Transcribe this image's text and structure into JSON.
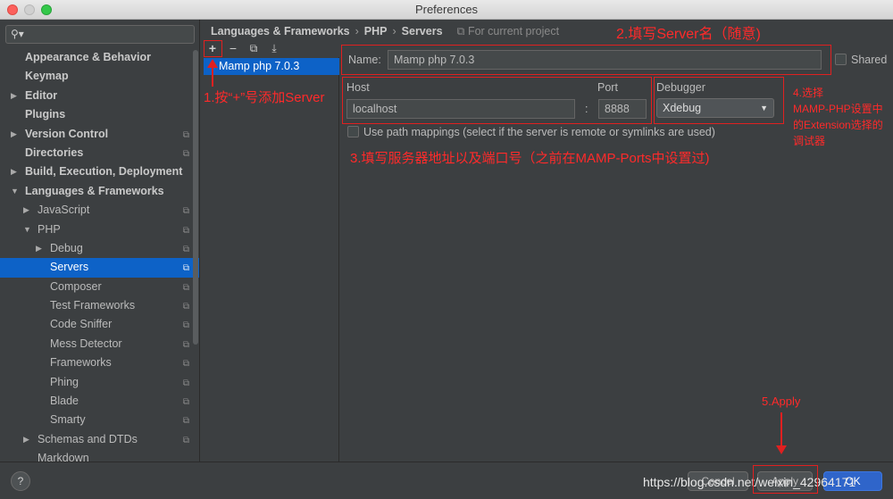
{
  "window": {
    "title": "Preferences"
  },
  "sidebar": {
    "search_placeholder": "",
    "items": [
      {
        "label": "Appearance & Behavior",
        "arrow": "",
        "bold": true,
        "cfg": false,
        "indent": 0
      },
      {
        "label": "Keymap",
        "arrow": "",
        "bold": true,
        "cfg": false,
        "indent": 0
      },
      {
        "label": "Editor",
        "arrow": "▶",
        "bold": true,
        "cfg": false,
        "indent": 0
      },
      {
        "label": "Plugins",
        "arrow": "",
        "bold": true,
        "cfg": false,
        "indent": 0
      },
      {
        "label": "Version Control",
        "arrow": "▶",
        "bold": true,
        "cfg": true,
        "indent": 0
      },
      {
        "label": "Directories",
        "arrow": "",
        "bold": true,
        "cfg": true,
        "indent": 0
      },
      {
        "label": "Build, Execution, Deployment",
        "arrow": "▶",
        "bold": true,
        "cfg": false,
        "indent": 0
      },
      {
        "label": "Languages & Frameworks",
        "arrow": "▼",
        "bold": true,
        "cfg": false,
        "indent": 0
      },
      {
        "label": "JavaScript",
        "arrow": "▶",
        "bold": false,
        "cfg": true,
        "indent": 1
      },
      {
        "label": "PHP",
        "arrow": "▼",
        "bold": false,
        "cfg": true,
        "indent": 1
      },
      {
        "label": "Debug",
        "arrow": "▶",
        "bold": false,
        "cfg": true,
        "indent": 2
      },
      {
        "label": "Servers",
        "arrow": "",
        "bold": false,
        "cfg": true,
        "indent": 2,
        "selected": true
      },
      {
        "label": "Composer",
        "arrow": "",
        "bold": false,
        "cfg": true,
        "indent": 2
      },
      {
        "label": "Test Frameworks",
        "arrow": "",
        "bold": false,
        "cfg": true,
        "indent": 2
      },
      {
        "label": "Code Sniffer",
        "arrow": "",
        "bold": false,
        "cfg": true,
        "indent": 2
      },
      {
        "label": "Mess Detector",
        "arrow": "",
        "bold": false,
        "cfg": true,
        "indent": 2
      },
      {
        "label": "Frameworks",
        "arrow": "",
        "bold": false,
        "cfg": true,
        "indent": 2
      },
      {
        "label": "Phing",
        "arrow": "",
        "bold": false,
        "cfg": true,
        "indent": 2
      },
      {
        "label": "Blade",
        "arrow": "",
        "bold": false,
        "cfg": true,
        "indent": 2
      },
      {
        "label": "Smarty",
        "arrow": "",
        "bold": false,
        "cfg": true,
        "indent": 2
      },
      {
        "label": "Schemas and DTDs",
        "arrow": "▶",
        "bold": false,
        "cfg": true,
        "indent": 1
      },
      {
        "label": "Markdown",
        "arrow": "",
        "bold": false,
        "cfg": false,
        "indent": 1
      }
    ]
  },
  "breadcrumb": {
    "part1": "Languages & Frameworks",
    "sep": "›",
    "part2": "PHP",
    "part3": "Servers",
    "project_icon": "copy-icon",
    "project_note": "For current project"
  },
  "toolbar": {
    "add": "+",
    "remove": "−",
    "copy_icon": "copy-icon",
    "import_icon": "import-icon"
  },
  "servers": [
    {
      "name": "Mamp php 7.0.3"
    }
  ],
  "form": {
    "name_label": "Name:",
    "name_value": "Mamp php 7.0.3",
    "shared_label": "Shared",
    "host_label": "Host",
    "host_value": "localhost",
    "colon": ":",
    "port_label": "Port",
    "port_value": "8888",
    "debugger_label": "Debugger",
    "debugger_value": "Xdebug",
    "path_mappings_label": "Use path mappings (select if the server is remote or symlinks are used)"
  },
  "buttons": {
    "help": "?",
    "cancel": "Cancel",
    "apply": "Apply",
    "ok": "OK"
  },
  "annotations": {
    "step1": "1.按“+”号添加Server",
    "step2": "2.填写Server名（随意)",
    "step3": "3.填写服务器地址以及端口号（之前在MAMP-Ports中设置过)",
    "step4_l1": "4.选择",
    "step4_l2": "MAMP-PHP设置中",
    "step4_l3": "的Extension选择的",
    "step4_l4": "调试器",
    "step5": "5.Apply",
    "color": "#e02020"
  },
  "watermark": "https://blog.csdn.net/weixin_42964171"
}
